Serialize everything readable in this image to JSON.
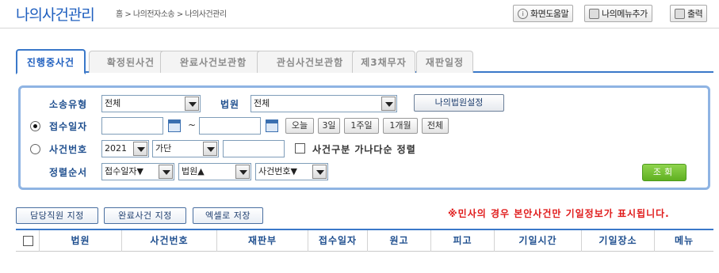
{
  "header": {
    "title": "나의사건관리",
    "breadcrumb": "홈 > 나의전자소송 > 나의사건관리",
    "help_label": "화면도움말",
    "add_menu_label": "나의메뉴추가",
    "print_label": "출력"
  },
  "tabs": [
    {
      "label": "진행중사건"
    },
    {
      "label": "확정된사건"
    },
    {
      "label": "완료사건보관함"
    },
    {
      "label": "관심사건보관함"
    },
    {
      "label": "제3채무자"
    },
    {
      "label": "재판일정"
    }
  ],
  "search": {
    "case_type_label": "소송유형",
    "case_type_value": "전체",
    "court_label": "법원",
    "court_value": "전체",
    "my_court_button": "나의법원설정",
    "receipt_date_label": "접수일자",
    "receipt_date_selected": true,
    "date_separator": "~",
    "period_buttons": [
      "오늘",
      "3일",
      "1주일",
      "1개월",
      "전체"
    ],
    "case_number_label": "사건번호",
    "case_year_value": "2021",
    "case_type_code_value": "가단",
    "case_sort_label": "사건구분 가나다순 정렬",
    "sort_order_label": "정렬순서",
    "sort_1": "접수일자▼",
    "sort_2": "법원▲",
    "sort_3": "사건번호▼",
    "search_button": "조회"
  },
  "actions": {
    "assign_staff": "담당직원 지정",
    "complete_case": "완료사건 지정",
    "save_excel": "엑셀로 저장",
    "notice": "※민사의 경우 본안사건만 기일정보가 표시됩니다."
  },
  "table": {
    "columns": [
      "법원",
      "사건번호",
      "재판부",
      "접수일자",
      "원고",
      "피고",
      "기일시간",
      "기일장소",
      "메뉴"
    ]
  }
}
